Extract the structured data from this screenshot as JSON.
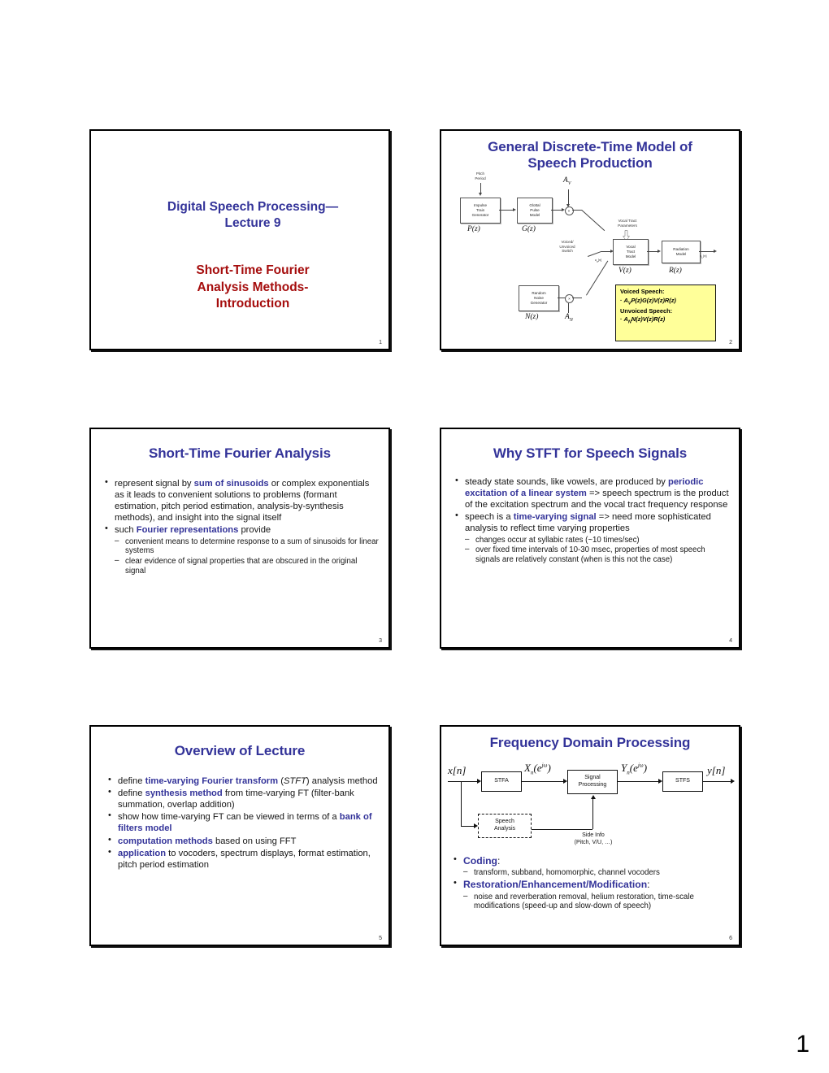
{
  "document": {
    "sheet_number": "1",
    "colors": {
      "title_blue": "#333399",
      "accent_red": "#A50C0C",
      "highlight_yellow": "#FFFF99"
    }
  },
  "slides": [
    {
      "number": "1",
      "title_blue": "Digital Speech Processing—\nLecture 9",
      "title_blue_line1": "Digital Speech Processing—",
      "title_blue_line2": "Lecture 9",
      "title_red_line1": "Short-Time Fourier",
      "title_red_line2": "Analysis Methods-",
      "title_red_line3": "Introduction"
    },
    {
      "number": "2",
      "title": "General Discrete-Time Model of Speech Production",
      "title_line1": "General Discrete-Time Model of",
      "title_line2": "Speech Production",
      "diagram": {
        "name": "speech-production-block-diagram",
        "labels": {
          "pitch_period": "Pitch\nPeriod",
          "impulse_train": "Impulse\nTrain\nGenerator",
          "glottal_pulse": "Glottal\nPulse\nModel",
          "vocal_tract_params": "Vocal Tract\nParameters",
          "vocal_tract_model": "Vocal\nTract\nModel",
          "radiation_model": "Radiation\nModel",
          "random_noise": "Random\nNoise\nGenerator",
          "switch": "Voiced/\nUnvoiced\nSwitch"
        },
        "math": {
          "p_z": "P(z)",
          "g_z": "G(z)",
          "v_z": "V(z)",
          "r_z": "R(z)",
          "n_z": "N(z)",
          "a_v": "A",
          "a_v_sub": "V",
          "a_n": "A",
          "a_n_sub": "N",
          "excitation": "u",
          "excitation_sub": "n",
          "excitation_idx": "[n]",
          "output": "p",
          "output_sub": "L",
          "output_idx": "[n]"
        }
      },
      "callout": {
        "voiced_heading": "Voiced Speech:",
        "voiced_eq_a": "A",
        "voiced_eq_sub": "V",
        "voiced_eq_rest": "P(z)G(z)V(z)R(z)",
        "unvoiced_heading": "Unvoiced Speech:",
        "unvoiced_eq_a": "A",
        "unvoiced_eq_sub": "N",
        "unvoiced_eq_rest": "N(z)V(z)R(z)",
        "bullet": "·"
      }
    },
    {
      "number": "3",
      "title": "Short-Time Fourier Analysis",
      "bullets": [
        {
          "pre": "represent signal by ",
          "bold": "sum of sinusoids",
          "post": " or complex exponentials as it leads to convenient solutions to problems (formant estimation, pitch period estimation, analysis-by-synthesis methods), and insight into the signal itself",
          "sub": []
        },
        {
          "pre": "such ",
          "bold": "Fourier representations",
          "post": " provide",
          "sub": [
            "convenient means to determine response to a sum of sinusoids for linear systems",
            "clear evidence of signal properties that are obscured in the original signal"
          ]
        }
      ]
    },
    {
      "number": "4",
      "title": "Why STFT for Speech Signals",
      "bullets": [
        {
          "pre": "steady state sounds, like vowels, are produced by ",
          "bold": "periodic excitation of a linear system",
          "post": " => speech spectrum is the product of the excitation spectrum and the vocal tract frequency response",
          "sub": []
        },
        {
          "pre": "speech is a ",
          "bold": "time-varying signal",
          "post": " => need more sophisticated analysis to reflect time varying properties",
          "sub": [
            "changes occur at syllabic rates (~10 times/sec)",
            "over fixed time intervals of 10-30 msec, properties of most speech signals are relatively constant (when is this not the case)"
          ]
        }
      ]
    },
    {
      "number": "5",
      "title": "Overview of Lecture",
      "bullets": [
        {
          "pre": "define ",
          "bold": "time-varying Fourier transform",
          "post_italic": "STFT",
          "post": " analysis method",
          "sub": []
        },
        {
          "pre": "define ",
          "bold": "synthesis method",
          "post": " from time-varying FT (filter-bank summation, overlap addition)",
          "sub": []
        },
        {
          "pre": "show how time-varying FT can be viewed in terms of a ",
          "bold": "bank of filters model",
          "post": "",
          "sub": []
        },
        {
          "pre": "",
          "bold": "computation methods",
          "post": " based on using FFT",
          "sub": []
        },
        {
          "pre": "",
          "bold": "application",
          "post": " to vocoders, spectrum displays, format estimation, pitch period estimation",
          "sub": []
        }
      ]
    },
    {
      "number": "6",
      "title": "Frequency Domain Processing",
      "diagram": {
        "name": "frequency-domain-processing-block-diagram",
        "input_signal": "x[n]",
        "output_signal": "y[n]",
        "blocks": [
          {
            "label": "STFA"
          },
          {
            "label": "Signal\nProcessing",
            "line1": "Signal",
            "line2": "Processing"
          },
          {
            "label": "STFS"
          },
          {
            "label": "Speech\nAnalysis",
            "line1": "Speech",
            "line2": "Analysis"
          }
        ],
        "signal_x": "X",
        "signal_x_sub": "n",
        "signal_y": "Y",
        "signal_y_sub": "n",
        "exp_term": "(e",
        "exp_sup": "jω",
        "exp_close": ")",
        "side_info_line1": "Side Info",
        "side_info_line2": "(Pitch, V/U, …)"
      },
      "bullets": [
        {
          "pre": "",
          "bold": "Coding",
          "post": ":",
          "sub": [
            "transform, subband, homomorphic, channel vocoders"
          ]
        },
        {
          "pre": "",
          "bold": "Restoration/Enhancement/Modification",
          "post": ":",
          "sub": [
            "noise and reverberation removal, helium restoration, time-scale modifications (speed-up and slow-down of speech)"
          ]
        }
      ]
    }
  ]
}
